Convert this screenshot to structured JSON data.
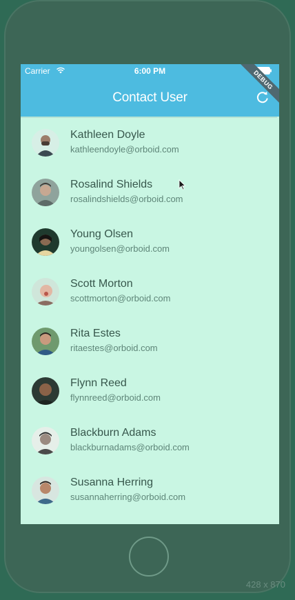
{
  "status_bar": {
    "carrier": "Carrier",
    "time": "6:00 PM"
  },
  "app_bar": {
    "title": "Contact User",
    "debug_banner": "DEBUG"
  },
  "contacts": [
    {
      "name": "Kathleen Doyle",
      "email": "kathleendoyle@orboid.com"
    },
    {
      "name": "Rosalind Shields",
      "email": "rosalindshields@orboid.com"
    },
    {
      "name": "Young Olsen",
      "email": "youngolsen@orboid.com"
    },
    {
      "name": "Scott Morton",
      "email": "scottmorton@orboid.com"
    },
    {
      "name": "Rita Estes",
      "email": "ritaestes@orboid.com"
    },
    {
      "name": "Flynn Reed",
      "email": "flynnreed@orboid.com"
    },
    {
      "name": "Blackburn Adams",
      "email": "blackburnadams@orboid.com"
    },
    {
      "name": "Susanna Herring",
      "email": "susannaherring@orboid.com"
    }
  ],
  "device_size_label": "428 x 870",
  "colors": {
    "app_bar": "#4dbbe0",
    "background": "#c9f6e3",
    "frame": "#3d6656"
  }
}
